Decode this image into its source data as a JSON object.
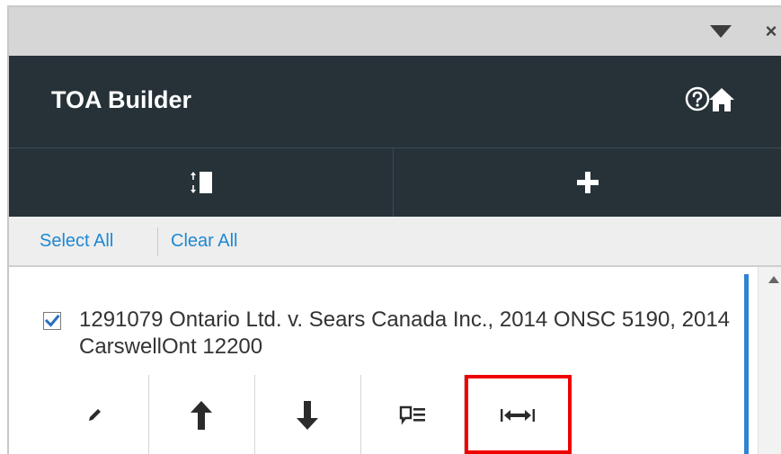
{
  "panel": {
    "title": "TOA Builder",
    "close_glyph": "×"
  },
  "icons": {
    "dropdown": "triangle-down-icon",
    "close": "close-icon",
    "help": "question-circle-icon",
    "home": "home-icon",
    "sort": "sort-bar-icon",
    "add": "plus-icon",
    "edit": "pencil-icon",
    "move_up": "arrow-up-icon",
    "move_down": "arrow-down-icon",
    "note": "comment-list-icon",
    "expand_width": "arrows-horizontal-icon"
  },
  "selection": {
    "select_all": "Select All",
    "clear_all": "Clear All"
  },
  "citations": [
    {
      "checked": true,
      "text": "1291079 Ontario Ltd. v. Sears Canada Inc., 2014 ONSC 5190, 2014 CarswellOnt 12200"
    }
  ],
  "colors": {
    "header_bg": "#263238",
    "link": "#1e88d4",
    "accent": "#2f82d0",
    "highlight": "#ee0000"
  }
}
